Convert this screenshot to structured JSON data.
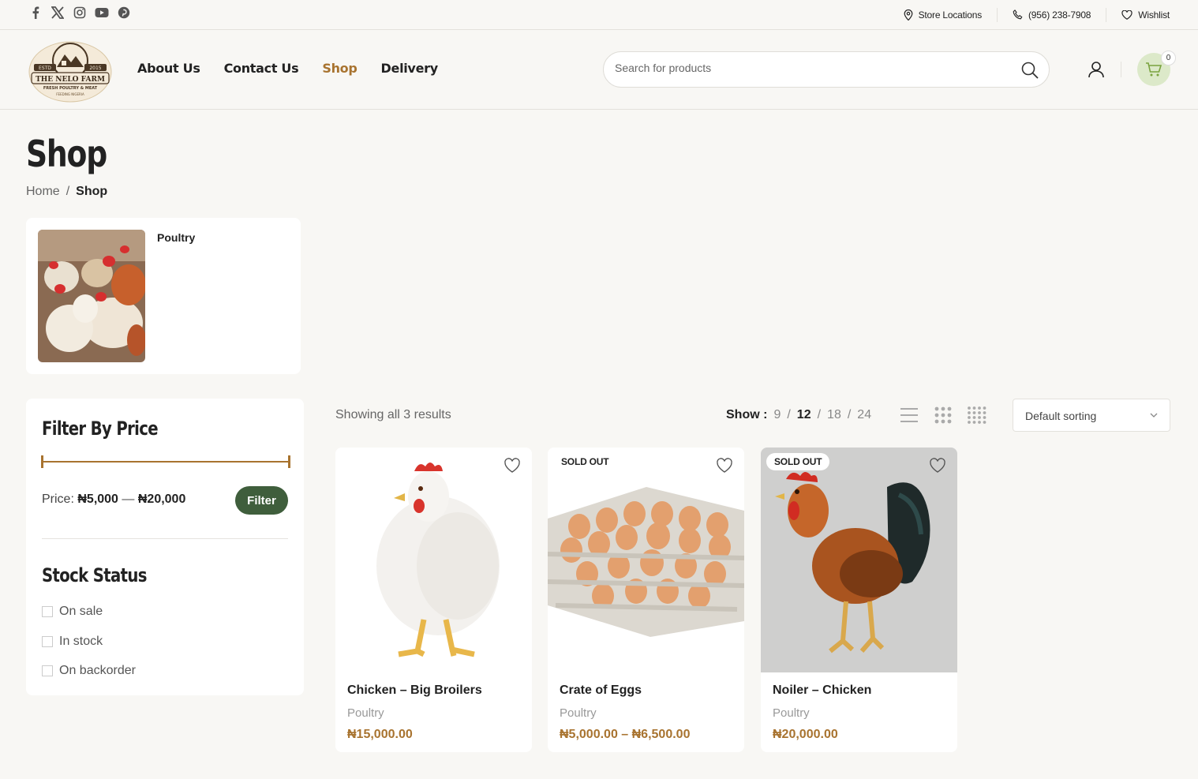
{
  "topbar": {
    "social": [
      "facebook-icon",
      "x-icon",
      "instagram-icon",
      "youtube-icon",
      "pinterest-icon"
    ],
    "store_locations": "Store Locations",
    "phone": "(956) 238-7908",
    "wishlist": "Wishlist"
  },
  "header": {
    "logo": {
      "estd": "ESTD",
      "year": "2015",
      "name": "THE NELO FARM",
      "tagline": "FRESH POULTRY & MEAT",
      "sub": "FEEDING NIGERIA"
    },
    "nav": [
      "About Us",
      "Contact Us",
      "Shop",
      "Delivery"
    ],
    "active_nav": "Shop",
    "search_placeholder": "Search for products",
    "cart_count": "0",
    "colors": {
      "accent": "#a8732f",
      "primary": "#3f5e3c",
      "cart_bg": "#dce9c9"
    }
  },
  "page": {
    "title": "Shop",
    "breadcrumb": {
      "home": "Home",
      "sep": "/",
      "current": "Shop"
    }
  },
  "category": {
    "name": "Poultry"
  },
  "filters": {
    "price_title": "Filter By Price",
    "price_label": "Price:",
    "price_min": "₦5,000",
    "price_dash": "—",
    "price_max": "₦20,000",
    "filter_button": "Filter",
    "stock_title": "Stock Status",
    "stock_options": [
      "On sale",
      "In stock",
      "On backorder"
    ]
  },
  "toolbar": {
    "results": "Showing all 3 results",
    "show_label": "Show :",
    "show_options": [
      "9",
      "12",
      "18",
      "24"
    ],
    "show_selected": "12",
    "sep": "/",
    "sort": "Default sorting"
  },
  "products": [
    {
      "name": "Chicken – Big Broilers",
      "category": "Poultry",
      "price": "₦15,000.00",
      "badge": ""
    },
    {
      "name": "Crate of Eggs",
      "category": "Poultry",
      "price": "₦5,000.00 – ₦6,500.00",
      "badge": "SOLD OUT"
    },
    {
      "name": "Noiler – Chicken",
      "category": "Poultry",
      "price": "₦20,000.00",
      "badge": "SOLD OUT"
    }
  ]
}
